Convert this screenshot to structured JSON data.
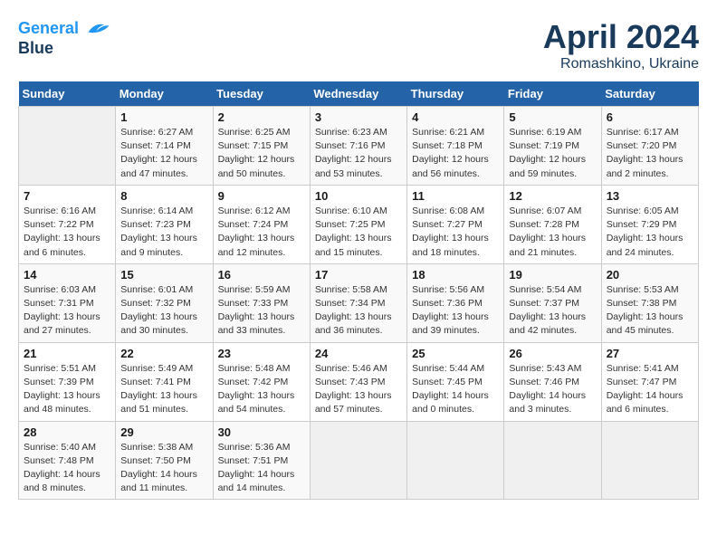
{
  "header": {
    "logo_line1": "General",
    "logo_line2": "Blue",
    "title": "April 2024",
    "subtitle": "Romashkino, Ukraine"
  },
  "weekdays": [
    "Sunday",
    "Monday",
    "Tuesday",
    "Wednesday",
    "Thursday",
    "Friday",
    "Saturday"
  ],
  "weeks": [
    [
      {
        "day": "",
        "info": ""
      },
      {
        "day": "1",
        "info": "Sunrise: 6:27 AM\nSunset: 7:14 PM\nDaylight: 12 hours\nand 47 minutes."
      },
      {
        "day": "2",
        "info": "Sunrise: 6:25 AM\nSunset: 7:15 PM\nDaylight: 12 hours\nand 50 minutes."
      },
      {
        "day": "3",
        "info": "Sunrise: 6:23 AM\nSunset: 7:16 PM\nDaylight: 12 hours\nand 53 minutes."
      },
      {
        "day": "4",
        "info": "Sunrise: 6:21 AM\nSunset: 7:18 PM\nDaylight: 12 hours\nand 56 minutes."
      },
      {
        "day": "5",
        "info": "Sunrise: 6:19 AM\nSunset: 7:19 PM\nDaylight: 12 hours\nand 59 minutes."
      },
      {
        "day": "6",
        "info": "Sunrise: 6:17 AM\nSunset: 7:20 PM\nDaylight: 13 hours\nand 2 minutes."
      }
    ],
    [
      {
        "day": "7",
        "info": "Sunrise: 6:16 AM\nSunset: 7:22 PM\nDaylight: 13 hours\nand 6 minutes."
      },
      {
        "day": "8",
        "info": "Sunrise: 6:14 AM\nSunset: 7:23 PM\nDaylight: 13 hours\nand 9 minutes."
      },
      {
        "day": "9",
        "info": "Sunrise: 6:12 AM\nSunset: 7:24 PM\nDaylight: 13 hours\nand 12 minutes."
      },
      {
        "day": "10",
        "info": "Sunrise: 6:10 AM\nSunset: 7:25 PM\nDaylight: 13 hours\nand 15 minutes."
      },
      {
        "day": "11",
        "info": "Sunrise: 6:08 AM\nSunset: 7:27 PM\nDaylight: 13 hours\nand 18 minutes."
      },
      {
        "day": "12",
        "info": "Sunrise: 6:07 AM\nSunset: 7:28 PM\nDaylight: 13 hours\nand 21 minutes."
      },
      {
        "day": "13",
        "info": "Sunrise: 6:05 AM\nSunset: 7:29 PM\nDaylight: 13 hours\nand 24 minutes."
      }
    ],
    [
      {
        "day": "14",
        "info": "Sunrise: 6:03 AM\nSunset: 7:31 PM\nDaylight: 13 hours\nand 27 minutes."
      },
      {
        "day": "15",
        "info": "Sunrise: 6:01 AM\nSunset: 7:32 PM\nDaylight: 13 hours\nand 30 minutes."
      },
      {
        "day": "16",
        "info": "Sunrise: 5:59 AM\nSunset: 7:33 PM\nDaylight: 13 hours\nand 33 minutes."
      },
      {
        "day": "17",
        "info": "Sunrise: 5:58 AM\nSunset: 7:34 PM\nDaylight: 13 hours\nand 36 minutes."
      },
      {
        "day": "18",
        "info": "Sunrise: 5:56 AM\nSunset: 7:36 PM\nDaylight: 13 hours\nand 39 minutes."
      },
      {
        "day": "19",
        "info": "Sunrise: 5:54 AM\nSunset: 7:37 PM\nDaylight: 13 hours\nand 42 minutes."
      },
      {
        "day": "20",
        "info": "Sunrise: 5:53 AM\nSunset: 7:38 PM\nDaylight: 13 hours\nand 45 minutes."
      }
    ],
    [
      {
        "day": "21",
        "info": "Sunrise: 5:51 AM\nSunset: 7:39 PM\nDaylight: 13 hours\nand 48 minutes."
      },
      {
        "day": "22",
        "info": "Sunrise: 5:49 AM\nSunset: 7:41 PM\nDaylight: 13 hours\nand 51 minutes."
      },
      {
        "day": "23",
        "info": "Sunrise: 5:48 AM\nSunset: 7:42 PM\nDaylight: 13 hours\nand 54 minutes."
      },
      {
        "day": "24",
        "info": "Sunrise: 5:46 AM\nSunset: 7:43 PM\nDaylight: 13 hours\nand 57 minutes."
      },
      {
        "day": "25",
        "info": "Sunrise: 5:44 AM\nSunset: 7:45 PM\nDaylight: 14 hours\nand 0 minutes."
      },
      {
        "day": "26",
        "info": "Sunrise: 5:43 AM\nSunset: 7:46 PM\nDaylight: 14 hours\nand 3 minutes."
      },
      {
        "day": "27",
        "info": "Sunrise: 5:41 AM\nSunset: 7:47 PM\nDaylight: 14 hours\nand 6 minutes."
      }
    ],
    [
      {
        "day": "28",
        "info": "Sunrise: 5:40 AM\nSunset: 7:48 PM\nDaylight: 14 hours\nand 8 minutes."
      },
      {
        "day": "29",
        "info": "Sunrise: 5:38 AM\nSunset: 7:50 PM\nDaylight: 14 hours\nand 11 minutes."
      },
      {
        "day": "30",
        "info": "Sunrise: 5:36 AM\nSunset: 7:51 PM\nDaylight: 14 hours\nand 14 minutes."
      },
      {
        "day": "",
        "info": ""
      },
      {
        "day": "",
        "info": ""
      },
      {
        "day": "",
        "info": ""
      },
      {
        "day": "",
        "info": ""
      }
    ]
  ]
}
